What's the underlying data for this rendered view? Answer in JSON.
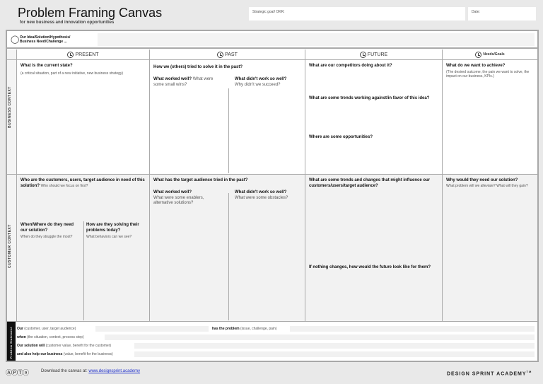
{
  "header": {
    "title": "Problem Framing Canvas",
    "subtitle": "for new business and innovation opportunities",
    "strategic_goal_label": "Strategic goal/ OKR:",
    "date_label": "Date:"
  },
  "idea": {
    "label_line1": "Our Idea/Solution/Hypothesis/",
    "label_line2": "Business Need/Challenge ..."
  },
  "columns": {
    "present": "PRESENT",
    "past": "PAST",
    "future": "FUTURE",
    "needs": "Needs/Goals"
  },
  "rows": {
    "business": "BUSINESS CONTEXT",
    "customer": "CUSTOMER CONTEXT",
    "statement": "Problem Statement"
  },
  "business": {
    "present_q": "What is the current state?",
    "present_h": "(a critical situation, part of a new initiative, new business strategy)",
    "past_q": "How we (others) tried to solve it in the past?",
    "past_well_q": "What worked well?",
    "past_well_h": "What were some small wins?",
    "past_notwell_q": "What didn't work so well?",
    "past_notwell_h": "Why didn't we succeed?",
    "future_q1": "What are our competitors doing about it?",
    "future_q2": "What are some trends working against/in favor of this idea?",
    "future_q3": "Where are some opportunities?",
    "needs_q": "What do we want to achieve?",
    "needs_h": "(The desired outcome, the pain we want to solve, the impact on our business, KPIs.)"
  },
  "customer": {
    "present_q": "Who are the customers, users, target audience in need of this solution?",
    "present_h": "Who should we focus on first?",
    "when_q": "When/Where do they need our solution?",
    "when_h": "When do they struggle the most?",
    "how_q": "How are they solving their problems today?",
    "how_h": "What behaviors can we see?",
    "past_q": "What has the target audience tried in the past?",
    "past_well_q": "What worked well?",
    "past_well_h": "What were some enablers, alternative solutions?",
    "past_notwell_q": "What didn't work so well?",
    "past_notwell_h": "What were some obstacles?",
    "future_q1": "What are some trends and changes that might influence our customers/users/target audience?",
    "future_q2": "If nothing changes, how would the future look like for them?",
    "needs_q": "Why would they need our solution?",
    "needs_h": "What problem will we alleviate? What will they gain?"
  },
  "statement": {
    "our": "Our",
    "our_h": "(customer, user, target audience)",
    "problem": "has the problem",
    "problem_h": "(issue, challenge, pain)",
    "when": "when",
    "when_h": "(the situation, context, process step)",
    "solution": "Our solution will",
    "solution_h": "(customer value, benefit for the customer)",
    "business": "and also help our business",
    "business_h": "(value, benefit for the business)"
  },
  "footer": {
    "download_text": "Download the canvas at:",
    "link": "www.designsprint.academy",
    "brand": "DESIGN SPRINT ACADEMY",
    "tm": "TM"
  }
}
